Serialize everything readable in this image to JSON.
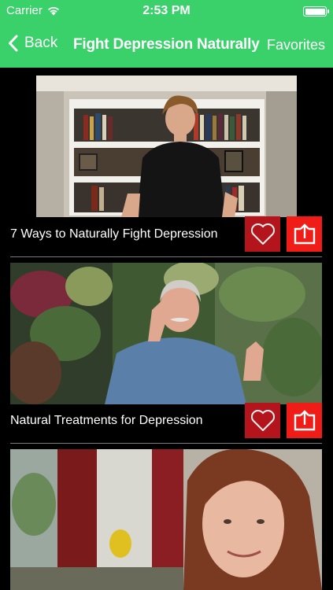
{
  "status_bar": {
    "carrier": "Carrier",
    "time": "2:53 PM",
    "wifi_icon": "wifi-icon",
    "battery_level": 1.0
  },
  "nav": {
    "back_label": "Back",
    "title": "Fight Depression Naturally",
    "favorites_label": "Favorites"
  },
  "videos": [
    {
      "title": "7 Ways to Naturally Fight Depression",
      "favorite_icon": "heart-outline-icon",
      "share_icon": "share-icon"
    },
    {
      "title": "Natural Treatments for Depression",
      "favorite_icon": "heart-outline-icon",
      "share_icon": "share-icon"
    },
    {
      "title": "",
      "favorite_icon": "heart-outline-icon",
      "share_icon": "share-icon"
    }
  ],
  "colors": {
    "header_green": "#3ad06a",
    "favorite_red": "#b4141b",
    "share_red": "#ef1c17",
    "background": "#000000"
  }
}
